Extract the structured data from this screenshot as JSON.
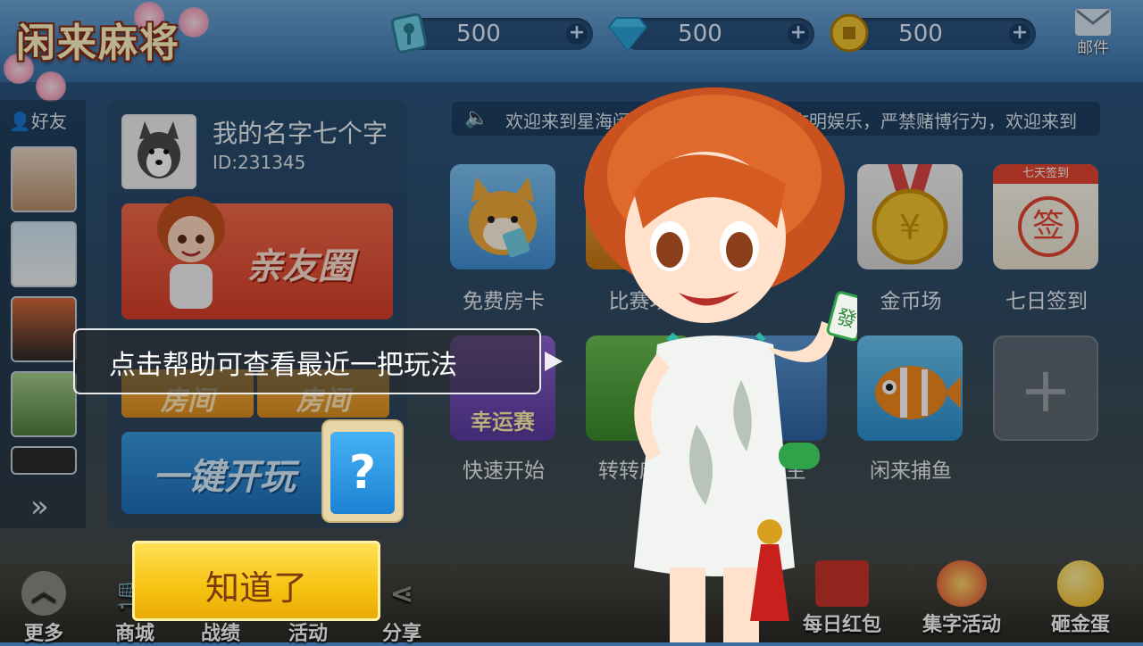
{
  "logo": "闲来麻将",
  "resources": [
    {
      "icon": "room-card-icon",
      "value": "500",
      "plus": "+"
    },
    {
      "icon": "diamond-icon",
      "value": "500",
      "plus": "+"
    },
    {
      "icon": "coin-icon",
      "value": "500",
      "plus": "+"
    }
  ],
  "mail": {
    "label": "邮件"
  },
  "friends": {
    "title": "好友",
    "more": "»"
  },
  "profile": {
    "name": "我的名字七个字",
    "id": "ID:231345"
  },
  "buttons": {
    "circle": "亲友圈",
    "create_room": "房间",
    "join_room": "房间",
    "quick_play": "一键开玩",
    "help": "?"
  },
  "marquee": {
    "text": "欢迎来到星海闲来麻将，健康游戏、文明娱乐，严禁赌博行为，欢迎来到"
  },
  "games": [
    {
      "label": "免费房卡",
      "color": "#5aa9e8"
    },
    {
      "label": "比赛场",
      "color": "#e8a13a"
    },
    {
      "label": "金币场",
      "color": "#f1c232"
    },
    {
      "label": "七日签到",
      "color": "#f5f1e8",
      "badge": "七天签到",
      "mark": "签"
    },
    {
      "label": "快速开始",
      "color": "#7b4fbf",
      "badge": "幸运赛"
    },
    {
      "label": "转转麻将",
      "color": "#4d9a3b"
    },
    {
      "label": "斗地主",
      "color": "#3b7fbf"
    },
    {
      "label": "闲来捕鱼",
      "color": "#3aa0e0"
    },
    {
      "label": "",
      "color": "#8c8f93",
      "mark": "+"
    }
  ],
  "bottom": [
    {
      "label": "更多"
    },
    {
      "label": "商城"
    },
    {
      "label": "战绩"
    },
    {
      "label": "活动"
    },
    {
      "label": "分享"
    },
    {
      "label": "每日红包"
    },
    {
      "label": "集字活动"
    },
    {
      "label": "砸金蛋"
    }
  ],
  "tip": {
    "text": "点击帮助可查看最近一把玩法",
    "ok": "知道了"
  },
  "tile_text": {
    "mahjong": "發"
  }
}
